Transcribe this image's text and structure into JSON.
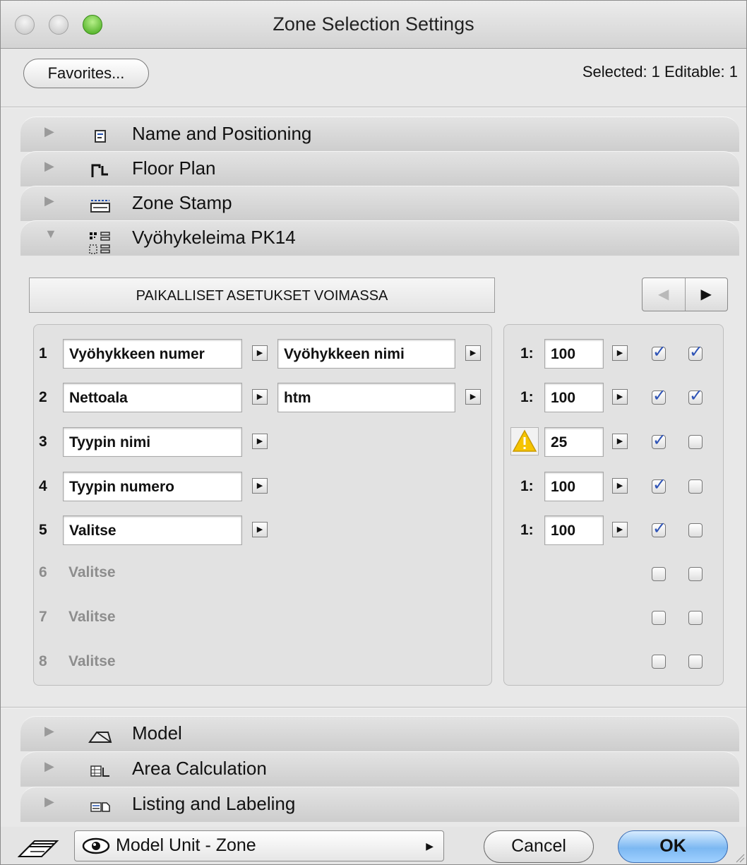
{
  "window": {
    "title": "Zone Selection Settings"
  },
  "header": {
    "favorites_label": "Favorites...",
    "selection_info": "Selected: 1 Editable: 1"
  },
  "panels_top": [
    {
      "label": "Name and Positioning",
      "icon": "name-positioning-icon",
      "expanded": false
    },
    {
      "label": "Floor Plan",
      "icon": "floor-plan-icon",
      "expanded": false
    },
    {
      "label": "Zone Stamp",
      "icon": "zone-stamp-icon",
      "expanded": false
    },
    {
      "label": "Vyöhykeleima PK14",
      "icon": "custom-stamp-icon",
      "expanded": true
    }
  ],
  "stamp": {
    "local_settings_label": "PAIKALLISET ASETUKSET VOIMASSA",
    "nav_prev": "◀",
    "nav_next": "▶",
    "rows": [
      {
        "num": "1",
        "field1": "Vyöhykkeen numer",
        "field2": "Vyöhykkeen nimi",
        "scale_prefix": "1:",
        "scale": "100",
        "warning": false,
        "check1": true,
        "check2": true
      },
      {
        "num": "2",
        "field1": "Nettoala",
        "field2": "htm",
        "scale_prefix": "1:",
        "scale": "100",
        "warning": false,
        "check1": true,
        "check2": true
      },
      {
        "num": "3",
        "field1": "Tyypin nimi",
        "field2": "",
        "scale_prefix": "",
        "scale": "25",
        "warning": true,
        "check1": true,
        "check2": false
      },
      {
        "num": "4",
        "field1": "Tyypin numero",
        "field2": "",
        "scale_prefix": "1:",
        "scale": "100",
        "warning": false,
        "check1": true,
        "check2": false
      },
      {
        "num": "5",
        "field1": "Valitse",
        "field2": "",
        "scale_prefix": "1:",
        "scale": "100",
        "warning": false,
        "check1": true,
        "check2": false
      },
      {
        "num": "6",
        "field1": "Valitse",
        "check1": false,
        "check2": false
      },
      {
        "num": "7",
        "field1": "Valitse",
        "check1": false,
        "check2": false
      },
      {
        "num": "8",
        "field1": "Valitse",
        "check1": false,
        "check2": false
      }
    ],
    "arrow_glyph": "▶"
  },
  "panels_bottom": [
    {
      "label": "Model",
      "icon": "model-icon",
      "expanded": false
    },
    {
      "label": "Area Calculation",
      "icon": "area-calculation-icon",
      "expanded": false
    },
    {
      "label": "Listing and Labeling",
      "icon": "listing-labeling-icon",
      "expanded": false
    }
  ],
  "footer": {
    "layer_value": "Model Unit - Zone",
    "popup_arrow": "▶",
    "cancel_label": "Cancel",
    "ok_label": "OK"
  },
  "colors": {
    "ok_button": "#7cb8f2",
    "check_mark": "#2e53b6",
    "warning": "#f5c400"
  }
}
